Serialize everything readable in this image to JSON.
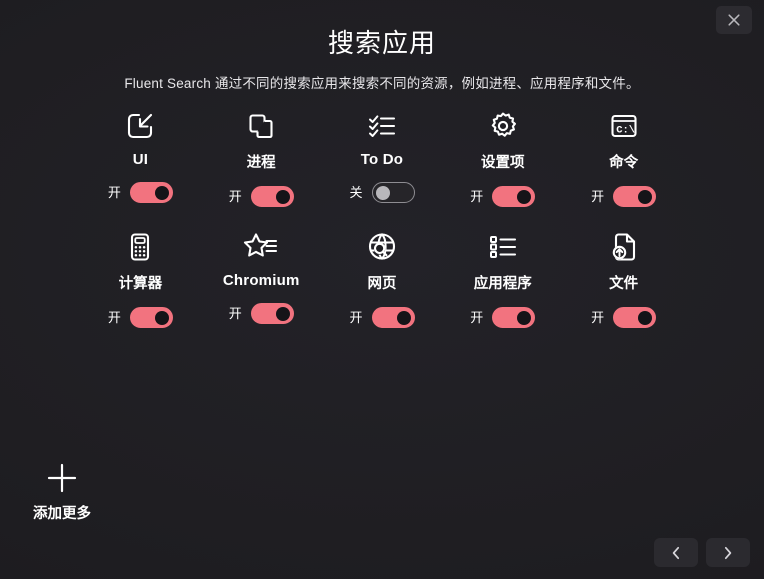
{
  "window": {
    "close_label": "×",
    "close_icon": "close-icon"
  },
  "header": {
    "title": "搜索应用",
    "subtitle": "Fluent Search 通过不同的搜索应用来搜索不同的资源，例如进程、应用程序和文件。"
  },
  "colors": {
    "background": "#1e1d21",
    "toggle_on": "#f2737f",
    "toggle_on_knob": "#151418",
    "toggle_off_border": "#8e8d92",
    "toggle_off_knob": "#b8b7bb",
    "text": "#ffffff",
    "button_bg": "#2b2a2f"
  },
  "apps": [
    {
      "label": "UI",
      "label_style": "latin",
      "icon": "ui-window-arrow-icon",
      "state_label": "开",
      "enabled": true
    },
    {
      "label": "进程",
      "label_style": "cjk",
      "icon": "process-windows-icon",
      "state_label": "开",
      "enabled": true
    },
    {
      "label": "To Do",
      "label_style": "latin",
      "icon": "todo-checklist-icon",
      "state_label": "关",
      "enabled": false
    },
    {
      "label": "设置项",
      "label_style": "cjk",
      "icon": "settings-gear-icon",
      "state_label": "开",
      "enabled": true
    },
    {
      "label": "命令",
      "label_style": "cjk",
      "icon": "command-console-icon",
      "state_label": "开",
      "enabled": true
    },
    {
      "label": "计算器",
      "label_style": "cjk",
      "icon": "calculator-icon",
      "state_label": "开",
      "enabled": true
    },
    {
      "label": "Chromium",
      "label_style": "latin",
      "icon": "chromium-bookmark-star-icon",
      "state_label": "开",
      "enabled": true
    },
    {
      "label": "网页",
      "label_style": "cjk",
      "icon": "web-globe-search-icon",
      "state_label": "开",
      "enabled": true
    },
    {
      "label": "应用程序",
      "label_style": "cjk",
      "icon": "applications-list-icon",
      "state_label": "开",
      "enabled": true
    },
    {
      "label": "文件",
      "label_style": "cjk",
      "icon": "file-upload-icon",
      "state_label": "开",
      "enabled": true
    }
  ],
  "add_more": {
    "label": "添加更多",
    "icon": "plus-icon"
  },
  "navigation": {
    "previous_icon": "chevron-left-icon",
    "next_icon": "chevron-right-icon"
  }
}
